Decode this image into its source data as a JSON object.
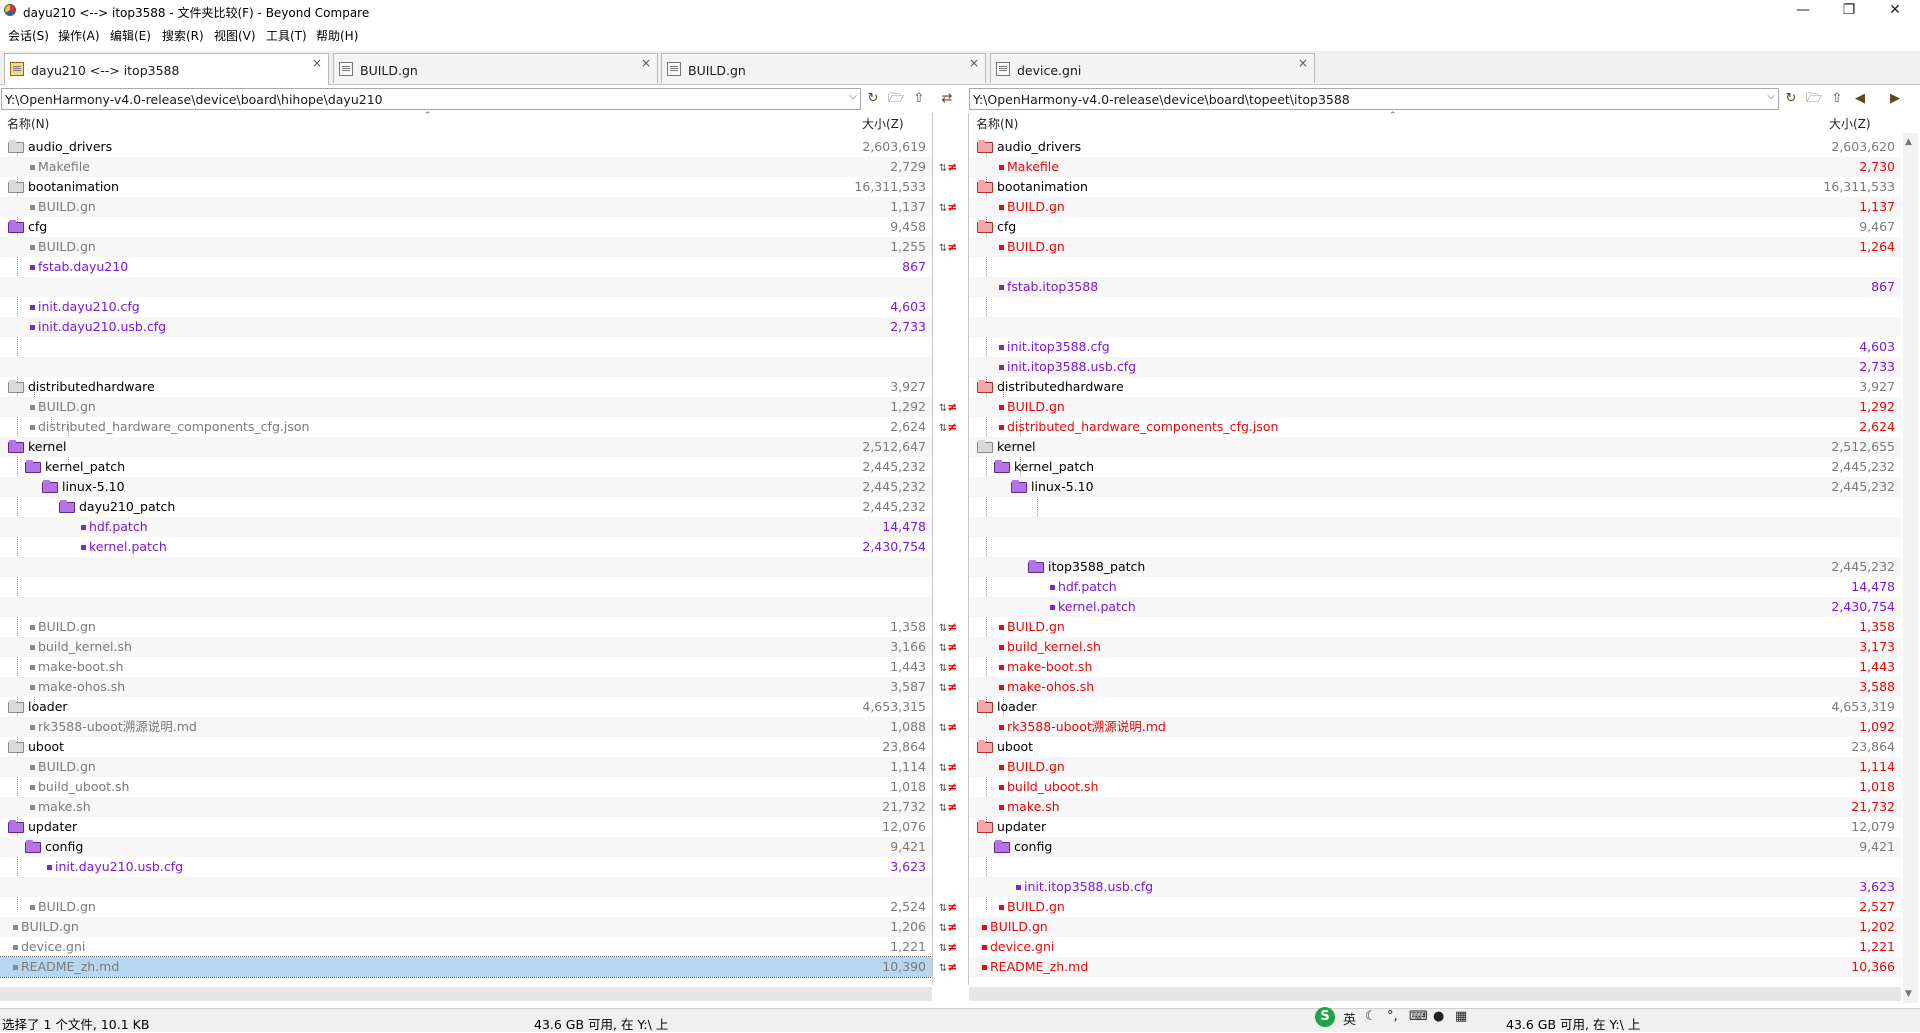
{
  "window": {
    "title": "dayu210 <--> itop3588 - 文件夹比较(F) - Beyond Compare"
  },
  "menu": [
    "会话(S)",
    "操作(A)",
    "编辑(E)",
    "搜索(R)",
    "视图(V)",
    "工具(T)",
    "帮助(H)"
  ],
  "tabs": [
    {
      "label": "dayu210 <--> itop3588",
      "close": "×"
    },
    {
      "label": "BUILD.gn",
      "close": "×"
    },
    {
      "label": "BUILD.gn",
      "close": "×"
    },
    {
      "label": "device.gni",
      "close": "×"
    }
  ],
  "left": {
    "path": "Y:\\OpenHarmony-v4.0-release\\device\\board\\hihope\\dayu210",
    "col_name": "名称(N)",
    "col_size": "大小(Z)",
    "rows": [
      {
        "name": "audio_drivers",
        "size": "2,603,619"
      },
      {
        "name": "Makefile",
        "size": "2,729"
      },
      {
        "name": "bootanimation",
        "size": "16,311,533"
      },
      {
        "name": "BUILD.gn",
        "size": "1,137"
      },
      {
        "name": "cfg",
        "size": "9,458"
      },
      {
        "name": "BUILD.gn",
        "size": "1,255"
      },
      {
        "name": "fstab.dayu210",
        "size": "867"
      },
      {
        "name": "",
        "size": ""
      },
      {
        "name": "init.dayu210.cfg",
        "size": "4,603"
      },
      {
        "name": "init.dayu210.usb.cfg",
        "size": "2,733"
      },
      {
        "name": "",
        "size": ""
      },
      {
        "name": "",
        "size": ""
      },
      {
        "name": "distributedhardware",
        "size": "3,927"
      },
      {
        "name": "BUILD.gn",
        "size": "1,292"
      },
      {
        "name": "distributed_hardware_components_cfg.json",
        "size": "2,624"
      },
      {
        "name": "kernel",
        "size": "2,512,647"
      },
      {
        "name": "kernel_patch",
        "size": "2,445,232"
      },
      {
        "name": "linux-5.10",
        "size": "2,445,232"
      },
      {
        "name": "dayu210_patch",
        "size": "2,445,232"
      },
      {
        "name": "hdf.patch",
        "size": "14,478"
      },
      {
        "name": "kernel.patch",
        "size": "2,430,754"
      },
      {
        "name": "",
        "size": ""
      },
      {
        "name": "",
        "size": ""
      },
      {
        "name": "",
        "size": ""
      },
      {
        "name": "BUILD.gn",
        "size": "1,358"
      },
      {
        "name": "build_kernel.sh",
        "size": "3,166"
      },
      {
        "name": "make-boot.sh",
        "size": "1,443"
      },
      {
        "name": "make-ohos.sh",
        "size": "3,587"
      },
      {
        "name": "loader",
        "size": "4,653,315"
      },
      {
        "name": "rk3588-uboot溯源说明.md",
        "size": "1,088"
      },
      {
        "name": "uboot",
        "size": "23,864"
      },
      {
        "name": "BUILD.gn",
        "size": "1,114"
      },
      {
        "name": "build_uboot.sh",
        "size": "1,018"
      },
      {
        "name": "make.sh",
        "size": "21,732"
      },
      {
        "name": "updater",
        "size": "12,076"
      },
      {
        "name": "config",
        "size": "9,421"
      },
      {
        "name": "init.dayu210.usb.cfg",
        "size": "3,623"
      },
      {
        "name": "",
        "size": ""
      },
      {
        "name": "BUILD.gn",
        "size": "2,524"
      },
      {
        "name": "BUILD.gn",
        "size": "1,206"
      },
      {
        "name": "device.gni",
        "size": "1,221"
      },
      {
        "name": "README_zh.md",
        "size": "10,390"
      }
    ]
  },
  "right": {
    "path": "Y:\\OpenHarmony-v4.0-release\\device\\board\\topeet\\itop3588",
    "col_name": "名称(N)",
    "col_size": "大小(Z)",
    "rows": [
      {
        "name": "audio_drivers",
        "size": "2,603,620"
      },
      {
        "name": "Makefile",
        "size": "2,730"
      },
      {
        "name": "bootanimation",
        "size": "16,311,533"
      },
      {
        "name": "BUILD.gn",
        "size": "1,137"
      },
      {
        "name": "cfg",
        "size": "9,467"
      },
      {
        "name": "BUILD.gn",
        "size": "1,264"
      },
      {
        "name": "",
        "size": ""
      },
      {
        "name": "fstab.itop3588",
        "size": "867"
      },
      {
        "name": "",
        "size": ""
      },
      {
        "name": "",
        "size": ""
      },
      {
        "name": "init.itop3588.cfg",
        "size": "4,603"
      },
      {
        "name": "init.itop3588.usb.cfg",
        "size": "2,733"
      },
      {
        "name": "distributedhardware",
        "size": "3,927"
      },
      {
        "name": "BUILD.gn",
        "size": "1,292"
      },
      {
        "name": "distributed_hardware_components_cfg.json",
        "size": "2,624"
      },
      {
        "name": "kernel",
        "size": "2,512,655"
      },
      {
        "name": "kernel_patch",
        "size": "2,445,232"
      },
      {
        "name": "linux-5.10",
        "size": "2,445,232"
      },
      {
        "name": "",
        "size": ""
      },
      {
        "name": "",
        "size": ""
      },
      {
        "name": "",
        "size": ""
      },
      {
        "name": "itop3588_patch",
        "size": "2,445,232"
      },
      {
        "name": "hdf.patch",
        "size": "14,478"
      },
      {
        "name": "kernel.patch",
        "size": "2,430,754"
      },
      {
        "name": "BUILD.gn",
        "size": "1,358"
      },
      {
        "name": "build_kernel.sh",
        "size": "3,173"
      },
      {
        "name": "make-boot.sh",
        "size": "1,443"
      },
      {
        "name": "make-ohos.sh",
        "size": "3,588"
      },
      {
        "name": "loader",
        "size": "4,653,319"
      },
      {
        "name": "rk3588-uboot溯源说明.md",
        "size": "1,092"
      },
      {
        "name": "uboot",
        "size": "23,864"
      },
      {
        "name": "BUILD.gn",
        "size": "1,114"
      },
      {
        "name": "build_uboot.sh",
        "size": "1,018"
      },
      {
        "name": "make.sh",
        "size": "21,732"
      },
      {
        "name": "updater",
        "size": "12,079"
      },
      {
        "name": "config",
        "size": "9,421"
      },
      {
        "name": "",
        "size": ""
      },
      {
        "name": "init.itop3588.usb.cfg",
        "size": "3,623"
      },
      {
        "name": "BUILD.gn",
        "size": "2,527"
      },
      {
        "name": "BUILD.gn",
        "size": "1,202"
      },
      {
        "name": "device.gni",
        "size": "1,221"
      },
      {
        "name": "README_zh.md",
        "size": "10,366"
      }
    ]
  },
  "status": {
    "selection": "选择了 1 个文件, 10.1 KB",
    "left_free": "43.6 GB 可用, 在 Y:\\ 上",
    "right_free": "43.6 GB 可用, 在 Y:\\ 上",
    "ime_mode": "英"
  },
  "colors": {
    "diff_red": "#e60a0a",
    "orphan_purple": "#7d18d8",
    "same_gray": "#7a7a7a",
    "selection": "#b8d6f0"
  }
}
